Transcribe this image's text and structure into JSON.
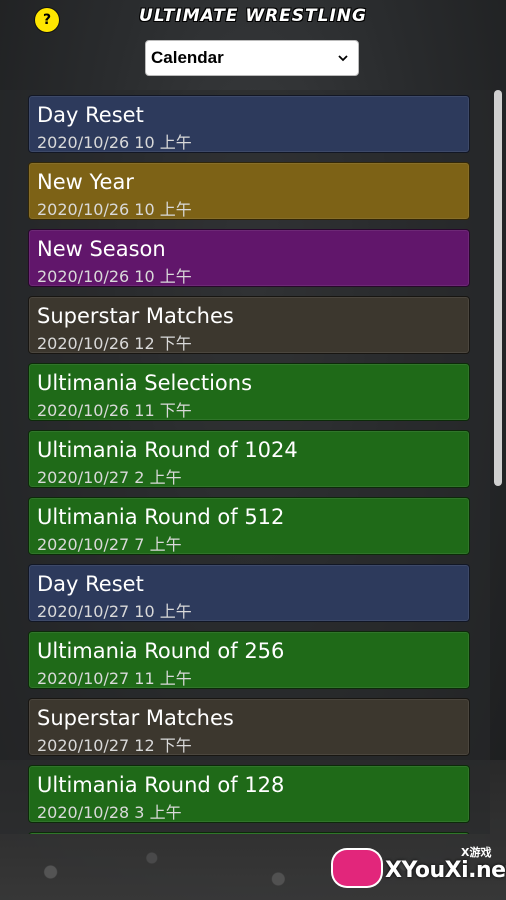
{
  "header": {
    "help_icon": "?",
    "title": "ULTIMATE WRESTLING",
    "view_select": {
      "value": "Calendar"
    }
  },
  "events": [
    {
      "title": "Day Reset",
      "date": "2020/10/26 10 上午",
      "color": "#2d3a5c"
    },
    {
      "title": "New Year",
      "date": "2020/10/26 10 上午",
      "color": "#7d6216"
    },
    {
      "title": "New Season",
      "date": "2020/10/26 10 上午",
      "color": "#61166b"
    },
    {
      "title": "Superstar Matches",
      "date": "2020/10/26 12 下午",
      "color": "#3c372e"
    },
    {
      "title": "Ultimania Selections",
      "date": "2020/10/26 11 下午",
      "color": "#1f6a18"
    },
    {
      "title": "Ultimania Round of 1024",
      "date": "2020/10/27 2 上午",
      "color": "#1f6a18"
    },
    {
      "title": "Ultimania Round of 512",
      "date": "2020/10/27 7 上午",
      "color": "#1f6a18"
    },
    {
      "title": "Day Reset",
      "date": "2020/10/27 10 上午",
      "color": "#2d3a5c"
    },
    {
      "title": "Ultimania Round of 256",
      "date": "2020/10/27 11 上午",
      "color": "#1f6a18"
    },
    {
      "title": " Superstar Matches",
      "date": "2020/10/27 12 下午",
      "color": "#3c372e"
    },
    {
      "title": "Ultimania Round of 128",
      "date": "2020/10/28 3 上午",
      "color": "#1f6a18"
    }
  ],
  "watermark": {
    "text": "XYouXi.net",
    "sub": "X游戏"
  }
}
